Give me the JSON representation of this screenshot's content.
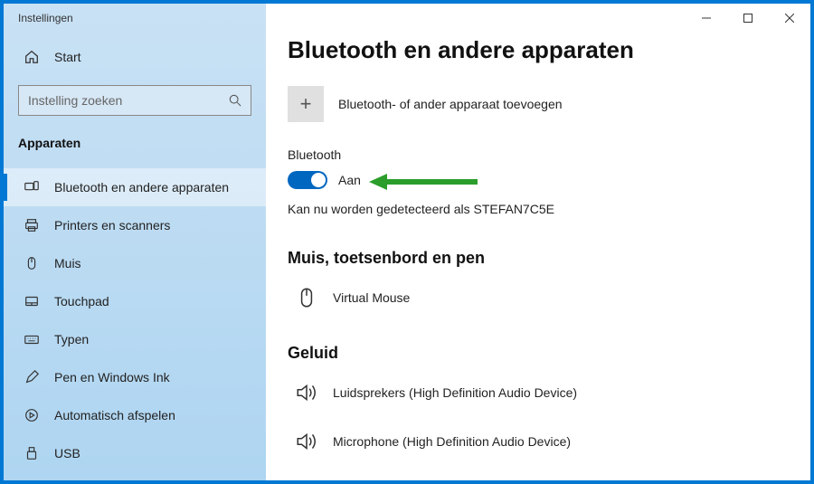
{
  "titlebar": {
    "app_name": "Instellingen"
  },
  "sidebar": {
    "home_label": "Start",
    "search_placeholder": "Instelling zoeken",
    "category_label": "Apparaten",
    "items": [
      {
        "label": "Bluetooth en andere apparaten",
        "active": true
      },
      {
        "label": "Printers en scanners"
      },
      {
        "label": "Muis"
      },
      {
        "label": "Touchpad"
      },
      {
        "label": "Typen"
      },
      {
        "label": "Pen en Windows Ink"
      },
      {
        "label": "Automatisch afspelen"
      },
      {
        "label": "USB"
      }
    ]
  },
  "main": {
    "title": "Bluetooth en andere apparaten",
    "add_device_label": "Bluetooth- of ander apparaat toevoegen",
    "bluetooth_header": "Bluetooth",
    "toggle_state_label": "Aan",
    "detect_line": "Kan nu worden gedetecteerd als STEFAN7C5E",
    "sections": {
      "mkb": {
        "heading": "Muis, toetsenbord en pen",
        "devices": [
          "Virtual Mouse"
        ]
      },
      "audio": {
        "heading": "Geluid",
        "devices": [
          "Luidsprekers (High Definition Audio Device)",
          "Microphone (High Definition Audio Device)"
        ]
      }
    }
  }
}
